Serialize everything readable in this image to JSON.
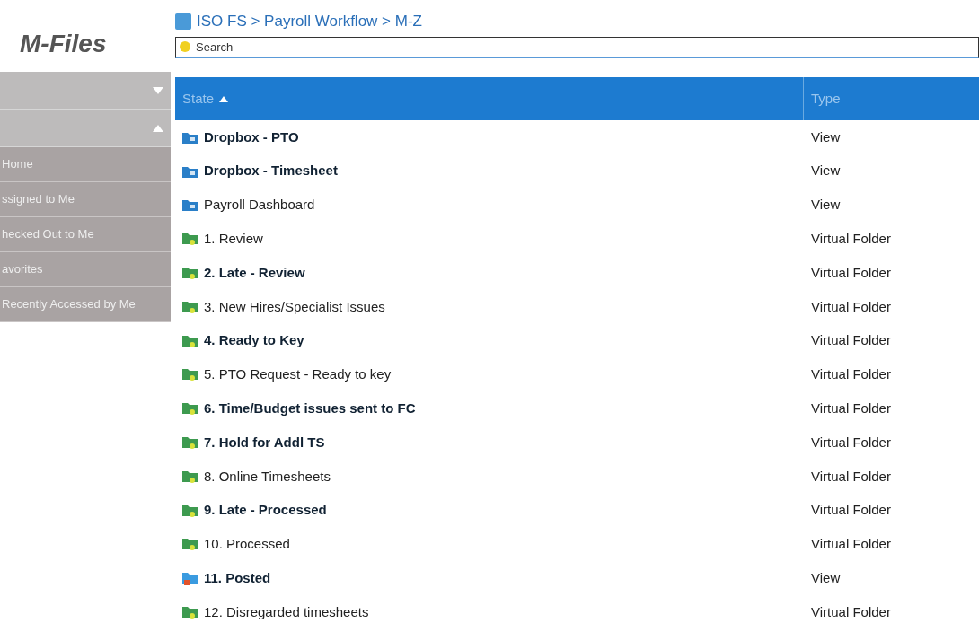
{
  "logo": "M-Files",
  "breadcrumb": "ISO FS > Payroll Workflow > M-Z",
  "search": {
    "placeholder": "Search"
  },
  "sidebar": {
    "sections": [
      {
        "expanded": false
      },
      {
        "expanded": true
      }
    ],
    "items": [
      {
        "label": "Home"
      },
      {
        "label": "ssigned to Me"
      },
      {
        "label": "hecked Out to Me"
      },
      {
        "label": "avorites"
      },
      {
        "label": "Recently Accessed by Me"
      }
    ]
  },
  "table": {
    "columns": [
      {
        "label": "State",
        "sorted": true
      },
      {
        "label": "Type",
        "sorted": false
      }
    ],
    "rows": [
      {
        "name": "Dropbox - PTO",
        "type": "View",
        "bold": true,
        "kind": "view"
      },
      {
        "name": "Dropbox - Timesheet",
        "type": "View",
        "bold": true,
        "kind": "view"
      },
      {
        "name": "Payroll Dashboard",
        "type": "View",
        "bold": false,
        "kind": "view"
      },
      {
        "name": "1. Review",
        "type": "Virtual Folder",
        "bold": false,
        "kind": "virtual"
      },
      {
        "name": "2. Late - Review",
        "type": "Virtual Folder",
        "bold": true,
        "kind": "virtual"
      },
      {
        "name": "3. New Hires/Specialist Issues",
        "type": "Virtual Folder",
        "bold": false,
        "kind": "virtual"
      },
      {
        "name": "4. Ready to Key",
        "type": "Virtual Folder",
        "bold": true,
        "kind": "virtual"
      },
      {
        "name": "5. PTO Request - Ready to key",
        "type": "Virtual Folder",
        "bold": false,
        "kind": "virtual"
      },
      {
        "name": "6. Time/Budget issues sent to FC",
        "type": "Virtual Folder",
        "bold": true,
        "kind": "virtual"
      },
      {
        "name": "7. Hold for Addl TS",
        "type": "Virtual Folder",
        "bold": true,
        "kind": "virtual"
      },
      {
        "name": "8. Online Timesheets",
        "type": "Virtual Folder",
        "bold": false,
        "kind": "virtual"
      },
      {
        "name": "9. Late - Processed",
        "type": "Virtual Folder",
        "bold": true,
        "kind": "virtual"
      },
      {
        "name": "10. Processed",
        "type": "Virtual Folder",
        "bold": false,
        "kind": "virtual"
      },
      {
        "name": "11. Posted",
        "type": "View",
        "bold": true,
        "kind": "posted"
      },
      {
        "name": "12. Disregarded timesheets",
        "type": "Virtual Folder",
        "bold": false,
        "kind": "virtual"
      }
    ]
  }
}
